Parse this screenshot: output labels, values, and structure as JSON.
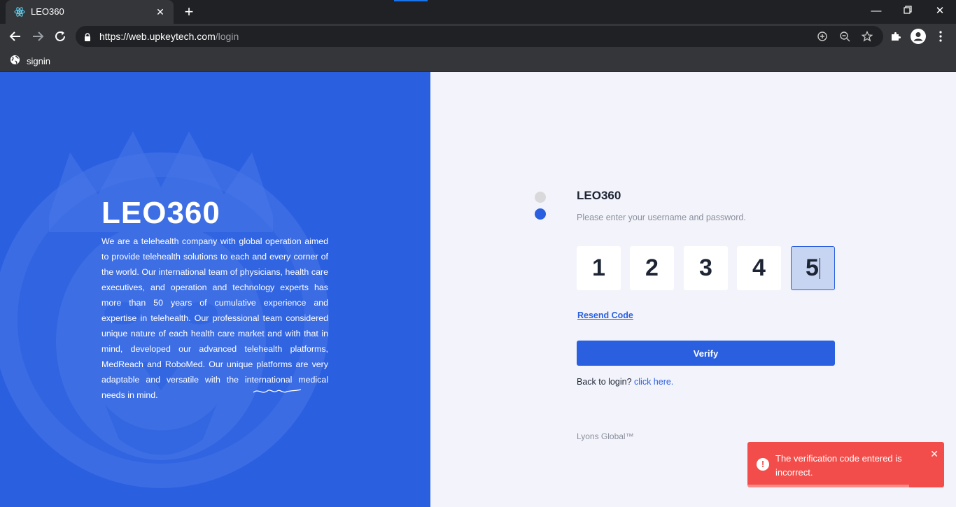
{
  "browser": {
    "tab_title": "LEO360",
    "url_host": "https://web.upkeytech.com",
    "url_path": "/login",
    "bookmark_label": "signin"
  },
  "brand_panel": {
    "logo_text": "LEO360",
    "about": "We are a telehealth company with global operation aimed to provide telehealth solutions to each and every corner of the world. Our international team of physicians, health care executives, and operation and technology experts has more than 50 years of cumulative experience and expertise in telehealth. Our professional team considered unique nature of each health care market and with that in mind, developed our advanced telehealth platforms, MedReach and RoboMed. Our unique platforms are very adaptable and versatile with the international medical needs in mind."
  },
  "verify_form": {
    "title": "LEO360",
    "subtitle": "Please enter your username and password.",
    "code_digits": [
      "1",
      "2",
      "3",
      "4",
      "5"
    ],
    "active_index": 4,
    "resend_label": "Resend Code",
    "verify_label": "Verify",
    "back_text": "Back to login?",
    "back_link": "click here.",
    "footer": "Lyons Global™"
  },
  "toast": {
    "message": "The verification code entered is incorrect.",
    "close_label": "✕"
  },
  "colors": {
    "brand_blue": "#2a5fe0",
    "error_red": "#f24d4a",
    "page_bg": "#f3f4fb"
  }
}
